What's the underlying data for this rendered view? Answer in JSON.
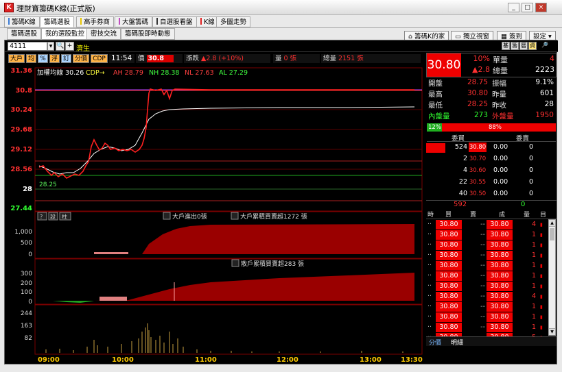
{
  "window": {
    "title": "理財寶籌碼K線(正式版)",
    "app_icon": "K",
    "buttons": [
      "_",
      "□",
      "×"
    ]
  },
  "top_tabs": [
    {
      "label": "籌碼K線",
      "mark_color": "#3a7bd5"
    },
    {
      "label": "籌碼選股",
      "mark_color": "",
      "active": true
    },
    {
      "label": "高手券商",
      "mark_color": "#e6c400"
    },
    {
      "label": "大盤籌碼",
      "mark_color": "#c04cc0"
    },
    {
      "label": "自選股看盤",
      "mark_color": "#333333"
    },
    {
      "label": "K線",
      "mark_color": "#e02020"
    },
    {
      "label": "多圖走勢",
      "mark_color": ""
    }
  ],
  "top_buttons": {
    "home": "籌碼K的家",
    "window": "獨立視窗",
    "signin": "簽到",
    "settings": "設定"
  },
  "sub_tabs": [
    "籌碼選股",
    "我的選股監控",
    "密技交流",
    "籌碼股即時動態"
  ],
  "toolbar": {
    "code": "4111",
    "name": "濟生",
    "right_tabs": [
      "基",
      "籌",
      "曆",
      "資"
    ]
  },
  "quote_bar": {
    "buttons": [
      "大戶",
      "均",
      "%",
      "浮",
      "訂",
      "分價",
      "CDP"
    ],
    "time": "11:54",
    "price_label": "價",
    "price": "30.8",
    "change_label": "漲跌",
    "change": "▲2.8 (+10%)",
    "vol_label": "量",
    "vol": "0 張",
    "total_label": "總量",
    "total": "2151 張"
  },
  "legend": {
    "avg": "加權均線",
    "avg_val": "30.26",
    "cdp": "CDP→",
    "ah": "AH 28.79",
    "nh": "NH 28.38",
    "nl": "NL 27.63",
    "al": "AL 27.29"
  },
  "price_axis": [
    "31.36",
    "30.8",
    "30.24",
    "29.68",
    "29.12",
    "28.56",
    "28",
    "27.44"
  ],
  "low_mark": "28.25",
  "panel2": {
    "buttons": [
      "?",
      "設",
      "柱"
    ],
    "t1": "大戶進出0張",
    "t2": "大戶累積買賣超1272 張",
    "ticks": [
      "1,000",
      "500",
      "0"
    ]
  },
  "panel3": {
    "t1": "散戶累積買賣超283 張",
    "ticks": [
      "300",
      "200",
      "100",
      "0"
    ]
  },
  "panel4": {
    "ticks": [
      "244",
      "163",
      "82"
    ]
  },
  "time_axis": [
    "09:00",
    "10:00",
    "11:00",
    "12:00",
    "13:00",
    "13:30"
  ],
  "right": {
    "price": "30.80",
    "pct": "10%",
    "chg": "▲2.8",
    "unit_label": "單量",
    "unit": "4",
    "total_label": "總量",
    "total": "2223",
    "rows": [
      {
        "l1": "開盤",
        "v1": "28.75",
        "l2": "振幅",
        "v2": "9.1%"
      },
      {
        "l1": "最高",
        "v1": "30.80",
        "l2": "昨量",
        "v2": "601"
      },
      {
        "l1": "最低",
        "v1": "28.25",
        "l2": "昨收",
        "v2": "28"
      }
    ],
    "inner_label": "內盤量",
    "inner": "273",
    "outer_label": "外盤量",
    "outer": "1950",
    "bar_left": "12%",
    "bar_right": "88%",
    "bid_hdr": "委買",
    "ask_hdr": "委賣",
    "book": [
      {
        "bq": "524",
        "bp": "30.80",
        "ap": "0.00",
        "aq": "0"
      },
      {
        "bq": "2",
        "bp": "30.70",
        "ap": "0.00",
        "aq": "0"
      },
      {
        "bq": "4",
        "bp": "30.60",
        "ap": "0.00",
        "aq": "0"
      },
      {
        "bq": "22",
        "bp": "30.55",
        "ap": "0.00",
        "aq": "0"
      },
      {
        "bq": "40",
        "bp": "30.50",
        "ap": "0.00",
        "aq": "0"
      }
    ],
    "bid_sum": "592",
    "ask_sum": "0",
    "tick_hdr": [
      "時",
      "買",
      "賣",
      "成",
      "量",
      "目"
    ],
    "ticks": [
      {
        "b": "30.80",
        "s": "--",
        "p": "30.80",
        "q": "4"
      },
      {
        "b": "30.80",
        "s": "--",
        "p": "30.80",
        "q": "1"
      },
      {
        "b": "30.80",
        "s": "--",
        "p": "30.80",
        "q": "1"
      },
      {
        "b": "30.80",
        "s": "--",
        "p": "30.80",
        "q": "1"
      },
      {
        "b": "30.80",
        "s": "--",
        "p": "30.80",
        "q": "1"
      },
      {
        "b": "30.80",
        "s": "--",
        "p": "30.80",
        "q": "1"
      },
      {
        "b": "30.80",
        "s": "--",
        "p": "30.80",
        "q": "1"
      },
      {
        "b": "30.80",
        "s": "--",
        "p": "30.80",
        "q": "4"
      },
      {
        "b": "30.80",
        "s": "--",
        "p": "30.80",
        "q": "1"
      },
      {
        "b": "30.80",
        "s": "--",
        "p": "30.80",
        "q": "1"
      },
      {
        "b": "30.80",
        "s": "--",
        "p": "30.80",
        "q": "1"
      },
      {
        "b": "30.80",
        "s": "--",
        "p": "30.80",
        "q": "5"
      },
      {
        "b": "30.80",
        "s": "--",
        "p": "30.80",
        "q": "1"
      }
    ],
    "bottom_tabs": [
      "分價",
      "明細"
    ]
  },
  "colors": {
    "up": "#ff2020",
    "down": "#20c020",
    "bg": "#000000",
    "axis_red": "#cc0000"
  }
}
